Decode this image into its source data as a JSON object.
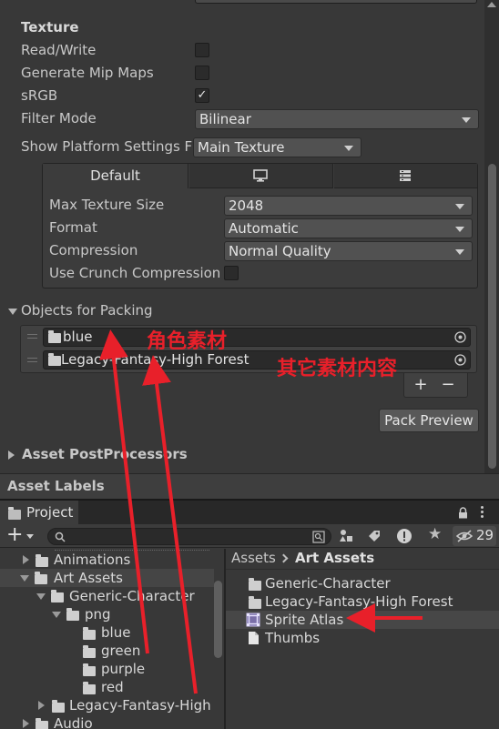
{
  "inspector": {
    "texture_header": "Texture",
    "read_write": {
      "label": "Read/Write",
      "checked": false
    },
    "mip_maps": {
      "label": "Generate Mip Maps",
      "checked": false
    },
    "srgb": {
      "label": "sRGB",
      "checked": true,
      "check_glyph": "✓"
    },
    "filter_mode": {
      "label": "Filter Mode",
      "value": "Bilinear"
    },
    "platform_settings": {
      "label": "Show Platform Settings F",
      "value": "Main Texture"
    },
    "platform_tabs": [
      {
        "label": "Default",
        "icon": null
      },
      {
        "label": "",
        "icon": "monitor-icon"
      },
      {
        "label": "",
        "icon": "server-icon"
      }
    ],
    "max_texture_size": {
      "label": "Max Texture Size",
      "value": "2048"
    },
    "format": {
      "label": "Format",
      "value": "Automatic"
    },
    "compression": {
      "label": "Compression",
      "value": "Normal Quality"
    },
    "crunch": {
      "label": "Use Crunch Compression",
      "checked": false
    },
    "objects_for_packing": {
      "label": "Objects for Packing",
      "items": [
        {
          "name": "blue"
        },
        {
          "name": "Legacy-Fantasy-High Forest"
        }
      ],
      "add_label": "+",
      "remove_label": "−"
    },
    "pack_preview_label": "Pack Preview",
    "asset_postprocessors": "Asset PostProcessors",
    "asset_labels": "Asset Labels"
  },
  "annotations": {
    "character_material": "角色素材",
    "other_material": "其它素材内容"
  },
  "project": {
    "tab_label": "Project",
    "create_label": "+",
    "hidden_count": "29",
    "tree": [
      {
        "label": "Animations"
      },
      {
        "label": "Art Assets"
      },
      {
        "label": "Generic-Character"
      },
      {
        "label": "png"
      },
      {
        "label": "blue"
      },
      {
        "label": "green"
      },
      {
        "label": "purple"
      },
      {
        "label": "red"
      },
      {
        "label": "Legacy-Fantasy-High"
      },
      {
        "label": "Audio"
      }
    ],
    "breadcrumb": {
      "root": "Assets",
      "current": "Art Assets"
    },
    "assets": [
      {
        "label": "Generic-Character",
        "icon": "folder-icon"
      },
      {
        "label": "Legacy-Fantasy-High Forest",
        "icon": "folder-icon"
      },
      {
        "label": "Sprite Atlas",
        "icon": "sprite-atlas-icon"
      },
      {
        "label": "Thumbs",
        "icon": "file-icon"
      }
    ]
  },
  "colors": {
    "background": "#383838",
    "annotation_red": "#e8202a",
    "selected_row": "#4a4a4a"
  }
}
